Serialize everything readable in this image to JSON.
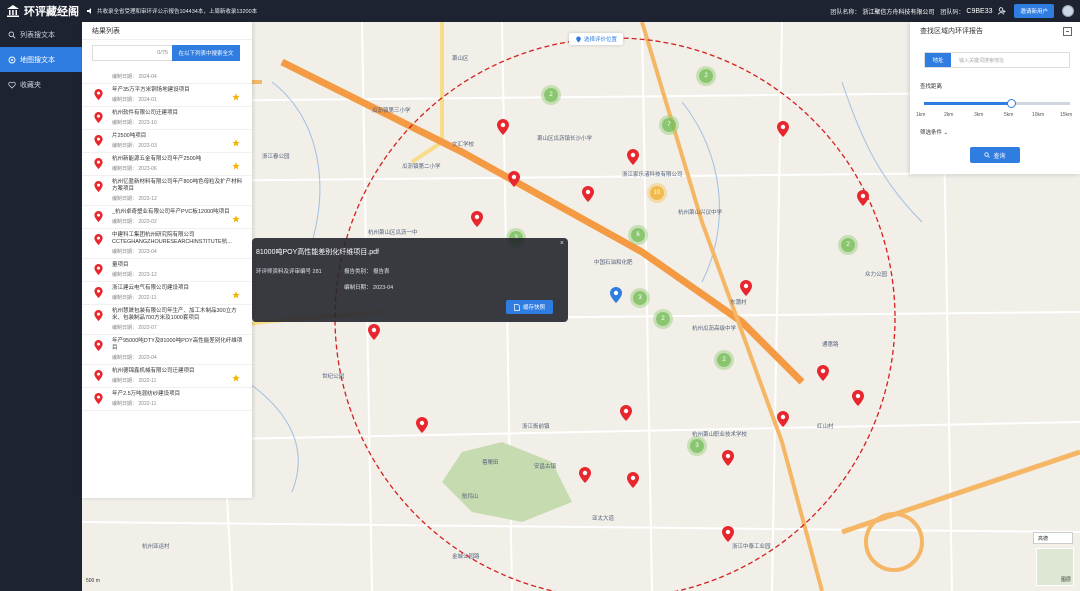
{
  "app": {
    "title": "环评藏经阁"
  },
  "notice": "共收录全省受理和审环评公示报告104434本，上周新收录13200本",
  "team": {
    "name_label": "团队名称：",
    "name": "浙江聚信方舟科技有限公司",
    "code_label": "团队码：",
    "code": "C9BE33",
    "invite": "邀请新用户"
  },
  "sidebar": {
    "items": [
      {
        "label": "列表搜文本",
        "icon": "search-icon",
        "active": false
      },
      {
        "label": "地图搜文本",
        "icon": "location-icon",
        "active": true
      },
      {
        "label": "收藏夹",
        "icon": "heart-icon",
        "active": false
      }
    ]
  },
  "results": {
    "title": "结果列表",
    "count": "0/75",
    "search_btn": "在以下列表中搜索全文",
    "items": [
      {
        "title": "",
        "date": "编制日期：  2024-04",
        "star": false
      },
      {
        "title": "年产35万平方米铜场地建设项目",
        "date": "编制日期：  2024-01",
        "star": true
      },
      {
        "title": "杭州软件有限公司迁建项目",
        "date": "编制日期：  2023-10",
        "star": false
      },
      {
        "title": "片2500吨项目",
        "date": "编制日期：  2023-03",
        "star": true
      },
      {
        "title": "杭州新能源五金有限公司年产2500吨",
        "date": "编制日期：  2023-06",
        "star": true
      },
      {
        "title": "杭州亿盈新材料有限公司年产800吨色母粒及扩产材料方案项目",
        "date": "编制日期：  2023-12",
        "star": false
      },
      {
        "title": "_杭州卓奇塑业有限公司年产PVC板12000吨项目",
        "date": "编制日期：  2023-02",
        "star": true
      },
      {
        "title": "中建科工集团杭州研究院有限公司 CCTEGHANGZHOURESEARCHINSTITUTE杭...",
        "date": "编制日期：  2023-04",
        "star": false
      },
      {
        "title": "量项目",
        "date": "编制日期：  2023-12",
        "star": false
      },
      {
        "title": "浙江建云电气有限公司建设项目",
        "date": "编制日期：  2022-11",
        "star": true
      },
      {
        "title": "杭州慧晟包装有限公司年生产、加工木制品300立方米、包装制品700方米及1000套项目",
        "date": "编制日期：  2022-07",
        "star": false
      },
      {
        "title": "年产95000吨DTY及81000吨POY高性能差别化纤维项目",
        "date": "编制日期：  2023-04",
        "star": false
      },
      {
        "title": "杭州德锦鑫机械有限公司迁建项目",
        "date": "编制日期：  2022-11",
        "star": true
      },
      {
        "title": "年产2.5万吨混纺纱建设项目",
        "date": "编制日期：  2022-11",
        "star": false
      }
    ]
  },
  "popup": {
    "title": "81000吨POY高性能差别化纤维项目.pdf",
    "info1": "环评师资料及评审编号 281",
    "info2": "报告类别：  报告表",
    "info3": "编制日期：  2023-04",
    "cache_btn": "缓存快照",
    "close": "×"
  },
  "map_chip": "选择评价位置",
  "finder": {
    "title": "查找区域内环评报告",
    "addr_tag": "地址",
    "addr_placeholder": "输入关键词搜索地址",
    "distance_label": "查找距离",
    "ticks": [
      "1km",
      "2km",
      "3km",
      "5km",
      "10km",
      "15km"
    ],
    "selected_distance_km": 5,
    "filter": "筛选条件 ⌄",
    "query_btn": "查询"
  },
  "map_labels": [
    "萧山区",
    "瓜沥镇第二小学",
    "文汇学校",
    "萧山区瓜沥镇长沙小学",
    "浙江家乐渚科技有限公司",
    "杭州萧山兴议中学",
    "浙江春公园",
    "杭州萧山区瓜沥一中",
    "中国石油和化肥",
    "瓜沥镇第三小学",
    "浙江衙前镇",
    "安昌古镇",
    "蓓栗田",
    "亚太大道",
    "众力公园",
    "杭州瓜沥高级中学",
    "东蒲村",
    "金城公园路",
    "通惠路",
    "浙江中泰工业园",
    "世纪公园",
    "杭州亚运村",
    "杭州萧山职业技术学校",
    "航坞山",
    "红山村"
  ],
  "map_footer": {
    "scale": "500 m",
    "map_type": "高德",
    "layer": "图层"
  },
  "colors": {
    "accent": "#2f7de1",
    "sidebar": "#1d2330",
    "pin": "#e8262e",
    "radius": "#d42020"
  }
}
